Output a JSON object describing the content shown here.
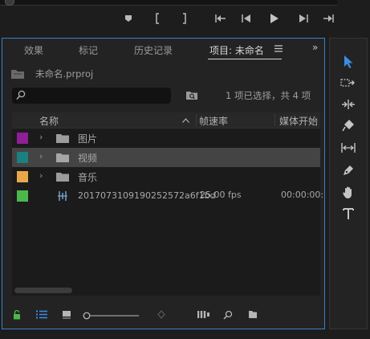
{
  "transport": {
    "buttons": [
      "marker",
      "in-point",
      "out-point",
      "go-to-in",
      "step-back",
      "play",
      "step-forward",
      "go-to-out"
    ]
  },
  "panel": {
    "tabs": [
      {
        "label": "效果",
        "active": false
      },
      {
        "label": "标记",
        "active": false
      },
      {
        "label": "历史记录",
        "active": false
      },
      {
        "label": "项目: 未命名",
        "active": true
      }
    ],
    "overflow": "»",
    "project_file": "未命名.prproj",
    "search": {
      "value": "",
      "placeholder": ""
    },
    "selection_status": "1 项已选择，共 4 项"
  },
  "columns": {
    "name": "名称",
    "fps": "帧速率",
    "start": "媒体开始"
  },
  "items": [
    {
      "label_color": "#8e1f94",
      "type": "bin",
      "name": "图片",
      "fps": "",
      "start": "",
      "selected": false
    },
    {
      "label_color": "#1c8080",
      "type": "bin",
      "name": "视频",
      "fps": "",
      "start": "",
      "selected": true
    },
    {
      "label_color": "#e8a84a",
      "type": "bin",
      "name": "音乐",
      "fps": "",
      "start": "",
      "selected": false
    },
    {
      "label_color": "#4cb84c",
      "type": "sequence",
      "name": "2017073109190252572a6f1bd",
      "fps": "25.00 fps",
      "start": "00:00:00:",
      "selected": false
    }
  ],
  "bottom_icons": [
    "lock-icon",
    "list-view-icon",
    "icon-view-icon",
    "zoom-slider",
    "sort-icon",
    "automate-to-sequence-icon",
    "find-icon",
    "new-bin-icon"
  ],
  "tools": [
    "selection-tool",
    "track-select-tool",
    "ripple-edit-tool",
    "razor-tool",
    "slip-tool",
    "pen-tool",
    "hand-tool",
    "type-tool"
  ],
  "colors": {
    "accent": "#3d7fc5",
    "active_tool": "#3a8ee6",
    "lock": "#4cb84c"
  }
}
